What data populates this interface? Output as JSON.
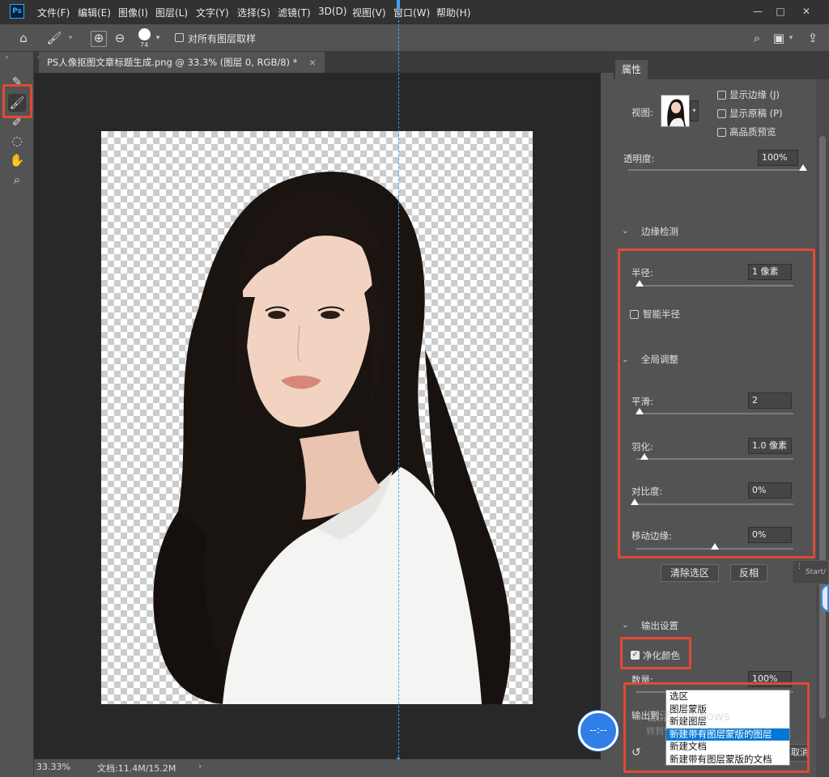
{
  "app": {
    "logo_text": "Ps"
  },
  "menu": [
    "文件(F)",
    "编辑(E)",
    "图像(I)",
    "图层(L)",
    "文字(Y)",
    "选择(S)",
    "滤镜(T)",
    "3D(D)",
    "视图(V)",
    "窗口(W)",
    "帮助(H)"
  ],
  "window_controls": {
    "minimize": "—",
    "maximize": "□",
    "close": "✕"
  },
  "options_bar": {
    "brush_size": "74",
    "sample_all_layers": "对所有图层取样"
  },
  "document": {
    "tab_title": "PS人像抠图文章标题生成.png @ 33.3% (图层 0, RGB/8) *",
    "tab_close": "×"
  },
  "status": {
    "zoom": "33.33%",
    "doc_info": "文档:11.4M/15.2M",
    "arrow": "›"
  },
  "panel": {
    "tab": "属性",
    "view_label": "视图:",
    "show_edge": "显示边缘 (J)",
    "show_original": "显示原稿 (P)",
    "hq_preview": "高品质预览",
    "opacity_label": "透明度:",
    "opacity_value": "100%",
    "opacity_level": 1.0,
    "edge_detection": {
      "title": "边缘检测",
      "radius_label": "半径:",
      "radius_value": "1 像素",
      "radius_level": 0.02,
      "smart_radius": "智能半径"
    },
    "global": {
      "title": "全局调整",
      "smooth_label": "平滑:",
      "smooth_value": "2",
      "smooth_level": 0.02,
      "feather_label": "羽化:",
      "feather_value": "1.0 像素",
      "feather_level": 0.05,
      "contrast_label": "对比度:",
      "contrast_value": "0%",
      "contrast_level": 0.0,
      "shift_label": "移动边缘:",
      "shift_value": "0%",
      "shift_level": 0.5
    },
    "clear_selection": "清除选区",
    "invert": "反相",
    "output": {
      "title": "输出设置",
      "decontaminate": "净化颜色",
      "amount_label": "数量:",
      "amount_value": "100%",
      "output_to_label": "输出到:",
      "cancel_fragment": "取消"
    }
  },
  "dropdown": {
    "options": [
      "选区",
      "图层蒙版",
      "新建图层",
      "新建带有图层蒙版的图层",
      "新建文档",
      "新建带有图层蒙版的文档"
    ],
    "selected_index": 3
  },
  "overlay": {
    "windows_watermark_1": "激活 Windows",
    "windows_watermark_2": "转到\"设置\"以激活 Windows。",
    "side_text": "Start/",
    "circle_text": "--:--"
  }
}
